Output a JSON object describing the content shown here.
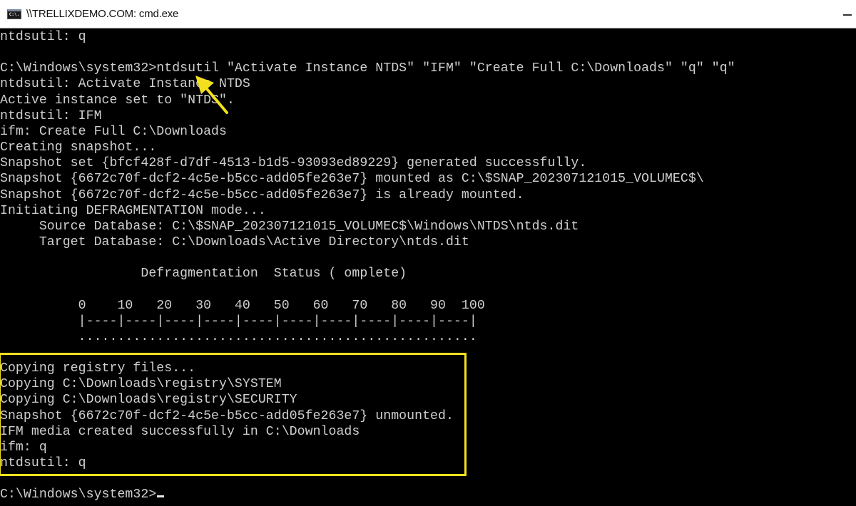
{
  "window": {
    "title": "\\\\TRELLIXDEMO.COM: cmd.exe",
    "icon": "cmd-icon",
    "icon_text": "C:\\."
  },
  "console": {
    "lines": [
      "ntdsutil: q",
      "",
      "C:\\Windows\\system32>ntdsutil \"Activate Instance NTDS\" \"IFM\" \"Create Full C:\\Downloads\" \"q\" \"q\"",
      "ntdsutil: Activate Instance NTDS",
      "Active instance set to \"NTDS\".",
      "ntdsutil: IFM",
      "ifm: Create Full C:\\Downloads",
      "Creating snapshot...",
      "Snapshot set {bfcf428f-d7df-4513-b1d5-93093ed89229} generated successfully.",
      "Snapshot {6672c70f-dcf2-4c5e-b5cc-add05fe263e7} mounted as C:\\$SNAP_202307121015_VOLUMEC$\\",
      "Snapshot {6672c70f-dcf2-4c5e-b5cc-add05fe263e7} is already mounted.",
      "Initiating DEFRAGMENTATION mode...",
      "     Source Database: C:\\$SNAP_202307121015_VOLUMEC$\\Windows\\NTDS\\ntds.dit",
      "     Target Database: C:\\Downloads\\Active Directory\\ntds.dit",
      "",
      "                  Defragmentation  Status ( omplete)",
      "",
      "          0    10   20   30   40   50   60   70   80   90  100",
      "          |----|----|----|----|----|----|----|----|----|----|",
      "          ...................................................",
      "",
      "Copying registry files...",
      "Copying C:\\Downloads\\registry\\SYSTEM",
      "Copying C:\\Downloads\\registry\\SECURITY",
      "Snapshot {6672c70f-dcf2-4c5e-b5cc-add05fe263e7} unmounted.",
      "IFM media created successfully in C:\\Downloads",
      "ifm: q",
      "ntdsutil: q",
      "",
      "C:\\Windows\\system32>"
    ],
    "defrag_progress_percent": 100
  },
  "annotations": {
    "highlight_color": "#f2e01e",
    "arrow_color": "#f2e01e",
    "arrow_target": "ntdsutil command",
    "highlight_target": "registry copy and IFM media creation output"
  }
}
